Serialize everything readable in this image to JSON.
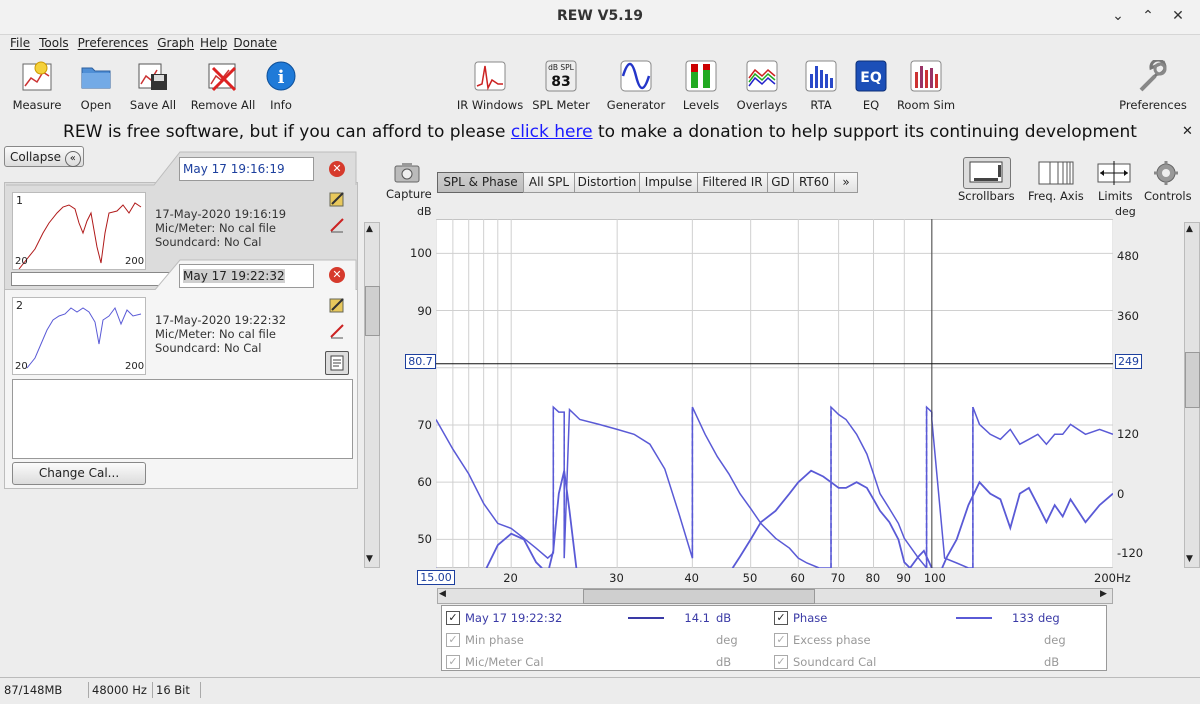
{
  "window": {
    "title": "REW V5.19"
  },
  "menu": [
    "File",
    "Tools",
    "Preferences",
    "Graph",
    "Help",
    "Donate"
  ],
  "toolbar_left": [
    "Measure",
    "Open",
    "Save All",
    "Remove All",
    "Info"
  ],
  "toolbar_mid": [
    "IR Windows",
    "SPL Meter",
    "Generator",
    "Levels",
    "Overlays",
    "RTA",
    "EQ",
    "Room Sim"
  ],
  "spl_meter_icon": {
    "top": "dB SPL",
    "value": "83"
  },
  "toolbar_right": "Preferences",
  "banner": {
    "before": "REW is free software, but if you can afford to please ",
    "link": "click here",
    "after": " to make a donation to help support its continuing development"
  },
  "left_panel": {
    "collapse_label": "Collapse",
    "measurements": [
      {
        "num": "1",
        "name": "May 17 19:16:19",
        "date": "17-May-2020 19:16:19",
        "mic": "Mic/Meter: No cal file",
        "soundcard": "Soundcard: No Cal",
        "thumb_min": "20",
        "thumb_max": "200"
      },
      {
        "num": "2",
        "name": "May 17 19:22:32",
        "date": "17-May-2020 19:22:32",
        "mic": "Mic/Meter: No cal file",
        "soundcard": "Soundcard: No Cal",
        "thumb_min": "20",
        "thumb_max": "200"
      }
    ],
    "change_cal_label": "Change Cal..."
  },
  "graph": {
    "capture_label": "Capture",
    "tabs": [
      "SPL & Phase",
      "All SPL",
      "Distortion",
      "Impulse",
      "Filtered IR",
      "GD",
      "RT60",
      "»"
    ],
    "selected_tab": "SPL & Phase",
    "right_tools": [
      "Scrollbars",
      "Freq. Axis",
      "Limits",
      "Controls"
    ],
    "left_unit": "dB",
    "right_unit": "deg",
    "x_unit": "Hz",
    "cursor_left_value": "80.7",
    "cursor_right_value": "249",
    "x_start_value": "15.00"
  },
  "chart_data": {
    "type": "line",
    "xscale": "log",
    "xlim": [
      15,
      200
    ],
    "ylim_left": [
      45,
      106
    ],
    "ylim_right": [
      -150,
      555
    ],
    "x_ticks": [
      20,
      30,
      40,
      50,
      60,
      70,
      80,
      90,
      100,
      200
    ],
    "y_ticks_left": [
      100,
      90,
      70,
      60,
      50
    ],
    "y_ticks_right": [
      480,
      360,
      120,
      0,
      -120
    ],
    "cursor": {
      "x": 100,
      "y": 80.7
    },
    "series": [
      {
        "name": "May 17 19:22:32",
        "axis": "left",
        "color": "#5a5ad6",
        "x": [
          15,
          16,
          17,
          18,
          19,
          20,
          21,
          22,
          23,
          23.5,
          24,
          24.5,
          25,
          26,
          27,
          28,
          30,
          32,
          34,
          36,
          38,
          40,
          42,
          44,
          46,
          48,
          50,
          52,
          55,
          58,
          60,
          63,
          66,
          68,
          70,
          72,
          75,
          78,
          80,
          82,
          85,
          88,
          90,
          92,
          95,
          97,
          100,
          103,
          106,
          110,
          115,
          120,
          125,
          130,
          135,
          140,
          145,
          150,
          155,
          160,
          165,
          170,
          180,
          190,
          200
        ],
        "y": [
          45,
          42,
          40,
          44,
          49,
          51,
          50,
          46,
          44,
          48,
          58,
          62,
          55,
          40,
          38,
          40,
          38,
          36,
          38,
          40,
          43,
          42,
          38,
          40,
          44,
          47,
          50,
          53,
          55,
          58,
          60,
          62,
          61,
          60,
          59,
          59,
          60,
          59,
          57,
          55,
          53,
          50,
          46,
          45,
          47,
          48,
          45,
          44,
          47,
          50,
          56,
          60,
          58,
          57,
          52,
          58,
          59,
          56,
          53,
          56,
          54,
          57,
          53,
          56,
          58
        ]
      },
      {
        "name": "Phase",
        "axis": "right",
        "color": "#5a5ad6",
        "x": [
          15,
          16,
          17,
          18,
          19,
          20,
          21,
          22,
          23,
          23.5,
          23.5,
          24,
          24.5,
          24.5,
          25,
          26,
          28,
          30,
          32,
          34,
          36,
          38,
          40,
          40,
          42,
          44,
          46,
          48,
          50,
          52,
          55,
          58,
          60,
          62,
          65,
          68,
          68,
          70,
          72,
          75,
          78,
          80,
          82,
          85,
          88,
          90,
          95,
          98,
          98,
          100,
          100,
          105,
          110,
          115,
          117,
          117,
          120,
          125,
          130,
          135,
          140,
          145,
          150,
          155,
          160,
          165,
          170,
          180,
          190,
          200
        ],
        "y": [
          150,
          90,
          40,
          -20,
          -60,
          -70,
          -90,
          -110,
          -130,
          -120,
          175,
          165,
          165,
          -130,
          170,
          150,
          140,
          130,
          120,
          100,
          50,
          -40,
          -130,
          175,
          120,
          75,
          40,
          0,
          -30,
          -60,
          -90,
          -110,
          -130,
          -140,
          -150,
          -150,
          175,
          160,
          150,
          120,
          80,
          40,
          0,
          -30,
          -60,
          -90,
          -130,
          -150,
          175,
          165,
          150,
          -130,
          -140,
          -150,
          -150,
          175,
          140,
          120,
          110,
          130,
          100,
          110,
          120,
          100,
          120,
          120,
          140,
          120,
          130,
          120
        ]
      }
    ]
  },
  "legend": {
    "rows": [
      {
        "checked": true,
        "enabled": true,
        "label": "May 17 19:22:32",
        "value": "14.1",
        "unit": "dB",
        "checked2": true,
        "enabled2": true,
        "label2": "Phase",
        "value2": "133",
        "unit2": "deg"
      },
      {
        "checked": true,
        "enabled": false,
        "label": "Min phase",
        "value": "",
        "unit": "deg",
        "checked2": true,
        "enabled2": false,
        "label2": "Excess phase",
        "value2": "",
        "unit2": "deg"
      },
      {
        "checked": true,
        "enabled": false,
        "label": "Mic/Meter Cal",
        "value": "",
        "unit": "dB",
        "checked2": true,
        "enabled2": false,
        "label2": "Soundcard Cal",
        "value2": "",
        "unit2": "dB"
      }
    ]
  },
  "status": {
    "memory": "87/148MB",
    "rate": "48000 Hz",
    "bits": "16 Bit"
  }
}
